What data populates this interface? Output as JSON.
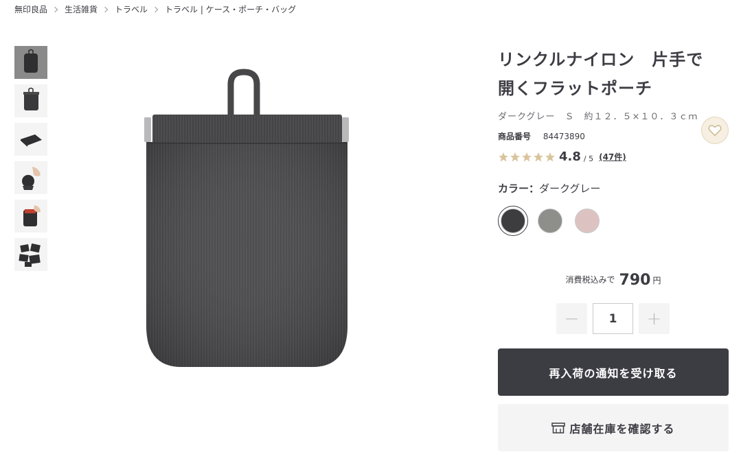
{
  "breadcrumb": [
    {
      "label": "無印良品"
    },
    {
      "label": "生活雑貨"
    },
    {
      "label": "トラベル"
    },
    {
      "label": "トラベル | ケース・ポーチ・バッグ"
    }
  ],
  "gallery": {
    "thumbnails": [
      {
        "icon": "pouch-front-thumbnail",
        "active": true
      },
      {
        "icon": "pouch-open-thumbnail"
      },
      {
        "icon": "pouch-flat-thumbnail"
      },
      {
        "icon": "pouch-in-hand-thumbnail"
      },
      {
        "icon": "pouch-hand-open-thumbnail"
      },
      {
        "icon": "pouch-set-thumbnail"
      }
    ],
    "main_image": "dark-grey-flat-pouch"
  },
  "product": {
    "title": "リンクルナイロン　片手で開くフラットポーチ",
    "variant": "ダークグレー　Ｓ　約１２．５×１０．３ｃｍ",
    "product_number_label": "商品番号",
    "product_number": "84473890",
    "rating": {
      "stars_filled": 5,
      "score": "4.8",
      "out_of": "/ 5",
      "reviews": "(47件)"
    },
    "color_label": "カラー：",
    "color_value": "ダークグレー",
    "swatches": [
      {
        "name": "ダークグレー",
        "color": "#3d3d3f",
        "selected": true
      },
      {
        "name": "グレー",
        "color": "#8e8f8b"
      },
      {
        "name": "ピンク",
        "color": "#dcc3c2"
      }
    ],
    "price": {
      "tax_label": "消費税込みで",
      "amount": "790",
      "currency": "円"
    },
    "quantity": {
      "minus": "−",
      "value": "1",
      "plus": "+"
    },
    "notify_button": "再入荷の通知を受け取る",
    "store_button": "店舗在庫を確認する"
  },
  "colors": {
    "primary_dark": "#3c3c43",
    "favorite_bg": "#f6efe2",
    "star": "#d9c49b"
  }
}
